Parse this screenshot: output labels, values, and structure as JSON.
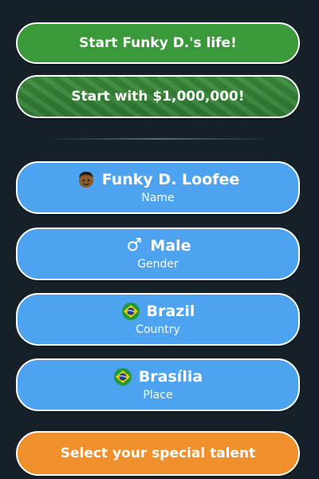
{
  "buttons": {
    "start_life": "Start Funky D.'s life!",
    "start_money": "Start with $1,000,000!",
    "talent": "Select your special talent"
  },
  "profile": {
    "name": {
      "value": "Funky D. Loofee",
      "label": "Name",
      "icon": "face-icon"
    },
    "gender": {
      "value": "Male",
      "label": "Gender",
      "icon": "male-symbol-icon",
      "glyph": "♂"
    },
    "country": {
      "value": "Brazil",
      "label": "Country",
      "icon": "brazil-flag-icon"
    },
    "place": {
      "value": "Brasília",
      "label": "Place",
      "icon": "brazil-flag-icon"
    }
  },
  "colors": {
    "green": "#3a9a3a",
    "blue": "#4da3f0",
    "orange": "#f0902d",
    "background": "#1b2530"
  }
}
